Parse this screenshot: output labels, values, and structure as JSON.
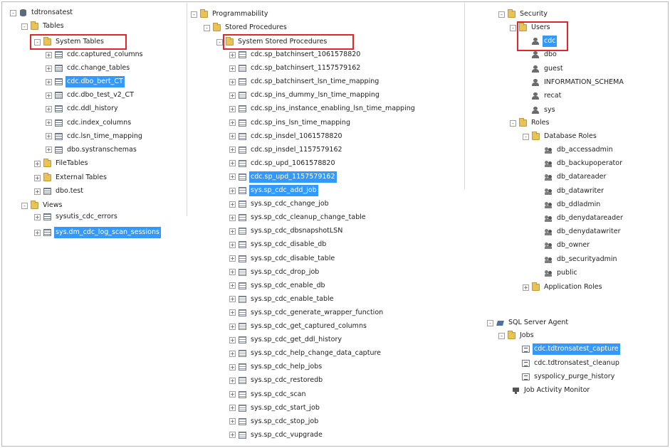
{
  "accent_selection": "#3399ff",
  "highlight_box_color": "#e0262b",
  "left_tree": {
    "db": "tdtronsatest",
    "tables_folder": "Tables",
    "system_tables_folder": "System Tables",
    "system_tables": [
      "cdc.captured_columns",
      "cdc.change_tables",
      "cdc.dbo_bert_CT",
      "cdc.dbo_test_v2_CT",
      "cdc.ddl_history",
      "cdc.index_columns",
      "cdc.lsn_time_mapping",
      "dbo.systranschemas"
    ],
    "selected_system_table": "cdc.dbo_bert_CT",
    "file_tables": "FileTables",
    "external_tables": "External Tables",
    "dbo_test": "dbo.test",
    "views_folder": "Views",
    "views": [
      "sysutis_cdc_errors",
      "sys.dm_cdc_log_scan_sessions"
    ],
    "selected_view": "sys.dm_cdc_log_scan_sessions"
  },
  "middle_tree": {
    "programmability": "Programmability",
    "stored_procedures": "Stored Procedures",
    "system_stored_procedures": "System Stored Procedures",
    "procedures": [
      "cdc.sp_batchinsert_1061578820",
      "cdc.sp_batchinsert_1157579162",
      "cdc.sp_batchinsert_lsn_time_mapping",
      "cdc.sp_ins_dummy_lsn_time_mapping",
      "cdc.sp_ins_instance_enabling_lsn_time_mapping",
      "cdc.sp_ins_lsn_time_mapping",
      "cdc.sp_insdel_1061578820",
      "cdc.sp_insdel_1157579162",
      "cdc.sp_upd_1061578820",
      "cdc.sp_upd_1157579162",
      "sys.sp_cdc_add_job",
      "sys.sp_cdc_change_job",
      "sys.sp_cdc_cleanup_change_table",
      "sys.sp_cdc_dbsnapshotLSN",
      "sys.sp_cdc_disable_db",
      "sys.sp_cdc_disable_table",
      "sys.sp_cdc_drop_job",
      "sys.sp_cdc_enable_db",
      "sys.sp_cdc_enable_table",
      "sys.sp_cdc_generate_wrapper_function",
      "sys.sp_cdc_get_captured_columns",
      "sys.sp_cdc_get_ddl_history",
      "sys.sp_cdc_help_change_data_capture",
      "sys.sp_cdc_help_jobs",
      "sys.sp_cdc_restoredb",
      "sys.sp_cdc_scan",
      "sys.sp_cdc_start_job",
      "sys.sp_cdc_stop_job",
      "sys.sp_cdc_vupgrade"
    ],
    "selected_procedures": [
      "cdc.sp_upd_1157579162",
      "sys.sp_cdc_add_job"
    ]
  },
  "right_tree": {
    "security": "Security",
    "users_folder": "Users",
    "users": [
      "cdc",
      "dbo",
      "guest",
      "INFORMATION_SCHEMA",
      "recat",
      "sys"
    ],
    "selected_user": "cdc",
    "roles_folder": "Roles",
    "database_roles": "Database Roles",
    "roles": [
      "db_accessadmin",
      "db_backupoperator",
      "db_datareader",
      "db_datawriter",
      "db_ddladmin",
      "db_denydatareader",
      "db_denydatawriter",
      "db_owner",
      "db_securityadmin",
      "public"
    ],
    "application_roles": "Application Roles",
    "agent": "SQL Server Agent",
    "jobs_folder": "Jobs",
    "jobs": [
      "cdc.tdtronsatest_capture",
      "cdc.tdtronsatest_cleanup",
      "syspolicy_purge_history"
    ],
    "selected_job": "cdc.tdtronsatest_capture",
    "job_activity_monitor": "Job Activity Monitor"
  }
}
